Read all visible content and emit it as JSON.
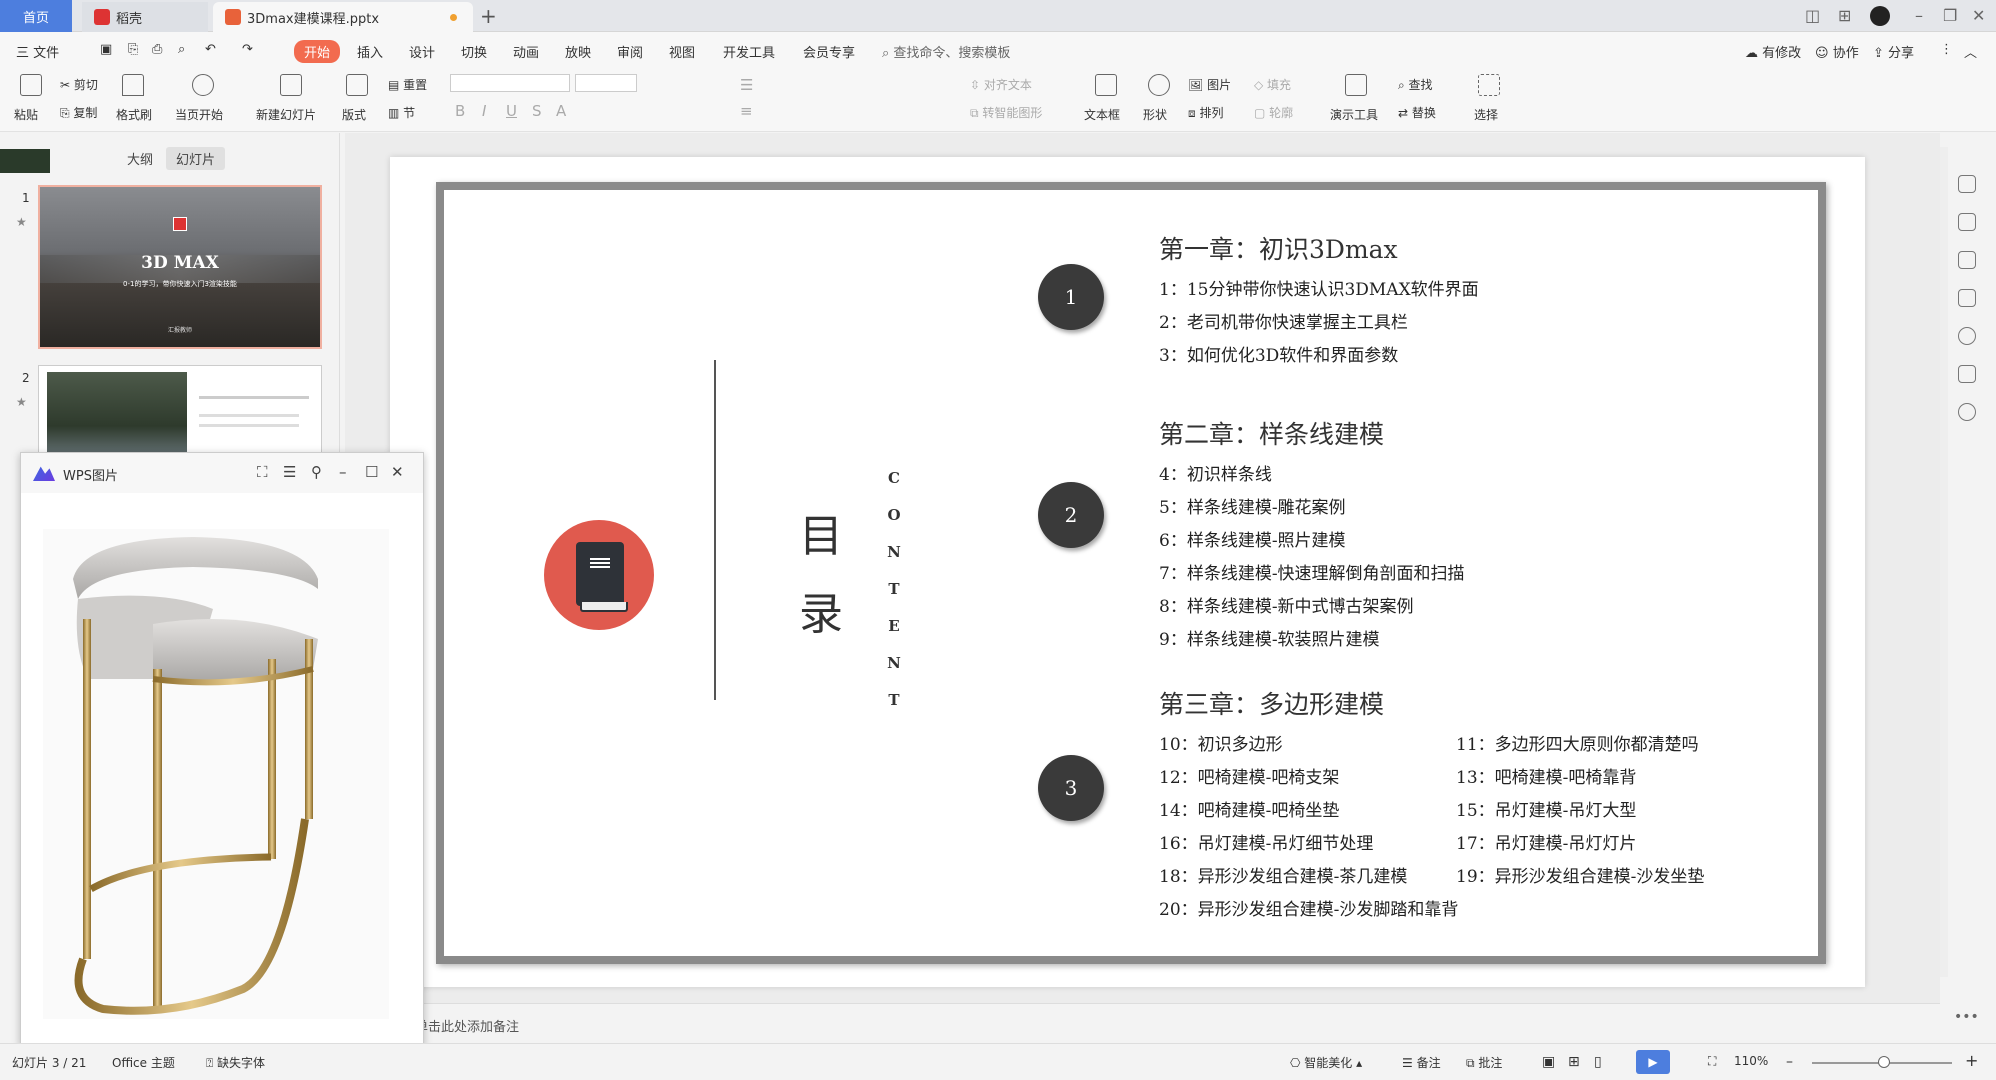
{
  "titlebar": {
    "tabs": [
      {
        "label": "首页"
      },
      {
        "label": "稻壳"
      },
      {
        "label": "3Dmax建模课程.pptx"
      }
    ],
    "new_tab": "+"
  },
  "menubar": {
    "file": "三 文件",
    "items": [
      "开始",
      "插入",
      "设计",
      "切换",
      "动画",
      "放映",
      "审阅",
      "视图",
      "开发工具",
      "会员专享"
    ],
    "search_placeholder": "查找命令、搜索模板",
    "right": {
      "modified": "有修改",
      "collab": "协作",
      "share": "分享"
    }
  },
  "ribbon": {
    "paste": "粘贴",
    "cut": "剪切",
    "copy": "复制",
    "format_painter": "格式刷",
    "start_from_current": "当页开始",
    "new_slide": "新建幻灯片",
    "layout": "版式",
    "reset": "重置",
    "section": "节",
    "align_text": "对齐文本",
    "smart_shape": "转智能图形",
    "textbox": "文本框",
    "shape": "形状",
    "picture": "图片",
    "fill": "填充",
    "arrange": "排列",
    "outline": "轮廓",
    "present_tool": "演示工具",
    "find": "查找",
    "replace": "替换",
    "select": "选择"
  },
  "leftpane": {
    "tabs": [
      "大纲",
      "幻灯片"
    ],
    "slides": [
      {
        "num": "1",
        "title": "3D MAX",
        "subtitle": "0-1的学习，带你快速入门3渲染技能",
        "footer": "汇报教师"
      },
      {
        "num": "2"
      }
    ]
  },
  "pic_viewer": {
    "title": "WPS图片"
  },
  "slide": {
    "mulu_1": "目",
    "mulu_2": "录",
    "content_letters": [
      "C",
      "O",
      "N",
      "T",
      "E",
      "N",
      "T"
    ],
    "chapters": [
      {
        "num": "1",
        "title": "第一章：初识3Dmax",
        "items": [
          "1：15分钟带你快速认识3DMAX软件界面",
          "2：老司机带你快速掌握主工具栏",
          "3：如何优化3D软件和界面参数"
        ]
      },
      {
        "num": "2",
        "title": "第二章：样条线建模",
        "items": [
          "4：初识样条线",
          "5：样条线建模-雕花案例",
          "6：样条线建模-照片建模",
          "7：样条线建模-快速理解倒角剖面和扫描",
          "8：样条线建模-新中式博古架案例",
          "9：样条线建模-软装照片建模"
        ]
      },
      {
        "num": "3",
        "title": "第三章：多边形建模",
        "items_left": [
          "10：初识多边形",
          "12：吧椅建模-吧椅支架",
          "14：吧椅建模-吧椅坐垫",
          "16：吊灯建模-吊灯细节处理",
          "18：异形沙发组合建模-茶几建模",
          "20：异形沙发组合建模-沙发脚踏和靠背"
        ],
        "items_right": [
          "11：多边形四大原则你都清楚吗",
          "13：吧椅建模-吧椅靠背",
          "15：吊灯建模-吊灯大型",
          "17：吊灯建模-吊灯灯片",
          "19：异形沙发组合建模-沙发坐垫"
        ]
      }
    ]
  },
  "notes": {
    "placeholder": "单击此处添加备注"
  },
  "statusbar": {
    "slide_pos": "幻灯片 3 / 21",
    "theme": "Office 主题",
    "missing_font": "缺失字体",
    "beautify": "智能美化",
    "notes": "备注",
    "comment": "批注",
    "zoom": "110%"
  },
  "colors": {
    "accent": "#f26b4f",
    "home_tab": "#4d7ede",
    "book_circle": "#e05a4e",
    "num_circle": "#3a3a3a"
  }
}
